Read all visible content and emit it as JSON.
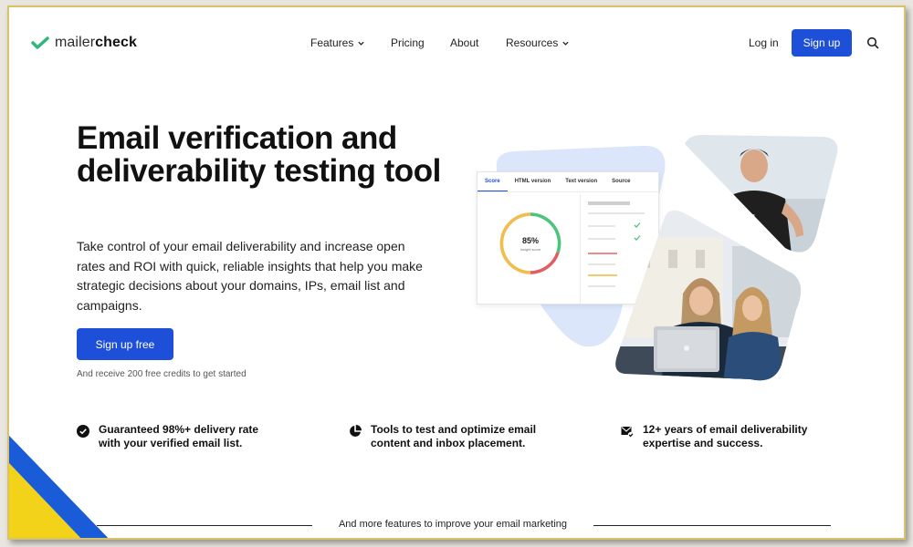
{
  "brand": {
    "name_light": "mailer",
    "name_bold": "check",
    "accent": "#1e4fd9",
    "logo_check": "#2fb67c"
  },
  "nav": {
    "items": [
      {
        "label": "Features",
        "has_dropdown": true
      },
      {
        "label": "Pricing",
        "has_dropdown": false
      },
      {
        "label": "About",
        "has_dropdown": false
      },
      {
        "label": "Resources",
        "has_dropdown": true
      }
    ],
    "login": "Log in",
    "signup": "Sign up",
    "search_icon": "search-icon"
  },
  "hero": {
    "title": "Email verification and deliverability testing tool",
    "description": "Take control of your email deliverability and increase open rates and ROI with quick, reliable insights that help you make strategic decisions about your domains, IPs, email list and campaigns.",
    "cta": "Sign up free",
    "note": "And receive 200 free credits to get started"
  },
  "report": {
    "tabs": [
      "Score",
      "HTML version",
      "Text version",
      "Source"
    ],
    "active_tab": "Score",
    "score": "85%",
    "score_label": "Insight score",
    "score_fraction": 0.85
  },
  "features": [
    {
      "icon": "check-circle-icon",
      "text": "Guaranteed 98%+ delivery rate with your verified email list."
    },
    {
      "icon": "pie-chart-icon",
      "text": "Tools to test and optimize email content and inbox placement."
    },
    {
      "icon": "email-check-icon",
      "text": "12+ years of email deliverability expertise and success."
    }
  ],
  "more_features": "And more features to improve your email marketing"
}
